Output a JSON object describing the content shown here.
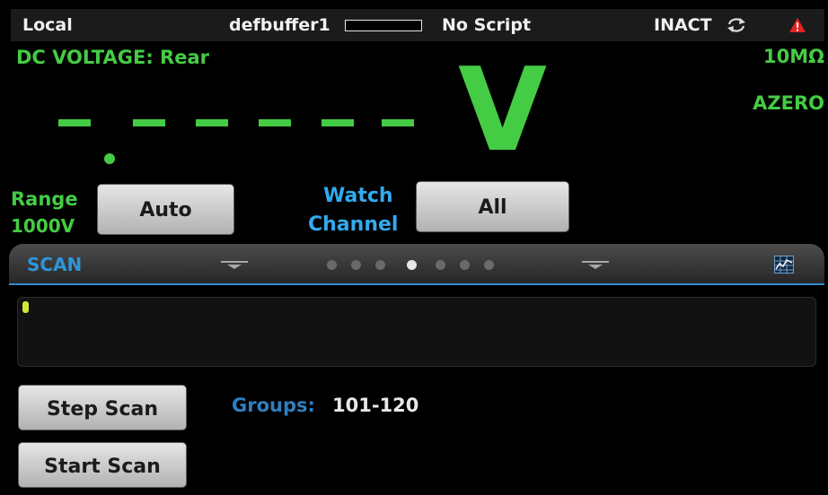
{
  "status_bar": {
    "mode": "Local",
    "buffer_name": "defbuffer1",
    "buffer_fill": 0,
    "script": "No Script",
    "trigger_state": "INACT",
    "icons": [
      "refresh-icon",
      "warning-icon"
    ]
  },
  "measurement": {
    "function": "DC VOLTAGE: Rear",
    "input_impedance": "10MΩ",
    "autozero": "AZERO",
    "reading": "- . - - - - - -",
    "unit": "V",
    "range_label": "Range",
    "range_value": "1000V",
    "range_button": "Auto",
    "watch_label_line1": "Watch",
    "watch_label_line2": "Channel",
    "watch_button": "All"
  },
  "scan_panel": {
    "title": "SCAN",
    "page_count": 7,
    "active_page": 4,
    "step_scan_button": "Step Scan",
    "start_scan_button": "Start Scan",
    "groups_label": "Groups:",
    "groups_value": "101-120"
  },
  "colors": {
    "measure_green": "#44cc44",
    "label_blue": "#33aaee",
    "scan_title_blue": "#2f95da",
    "warning_red": "#e52222"
  }
}
